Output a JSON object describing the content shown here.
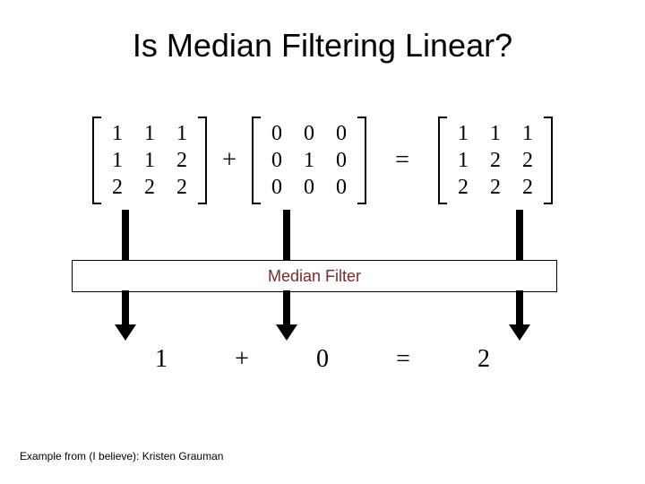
{
  "title": "Is Median Filtering Linear?",
  "matrices": {
    "A": [
      [
        "1",
        "1",
        "1"
      ],
      [
        "1",
        "1",
        "2"
      ],
      [
        "2",
        "2",
        "2"
      ]
    ],
    "B": [
      [
        "0",
        "0",
        "0"
      ],
      [
        "0",
        "1",
        "0"
      ],
      [
        "0",
        "0",
        "0"
      ]
    ],
    "C": [
      [
        "1",
        "1",
        "1"
      ],
      [
        "1",
        "2",
        "2"
      ],
      [
        "2",
        "2",
        "2"
      ]
    ]
  },
  "ops": {
    "plus": "+",
    "equals": "="
  },
  "filter_label": "Median Filter",
  "results": {
    "a": "1",
    "b": "0",
    "c": "2"
  },
  "footer": "Example from (I believe): Kristen Grauman"
}
